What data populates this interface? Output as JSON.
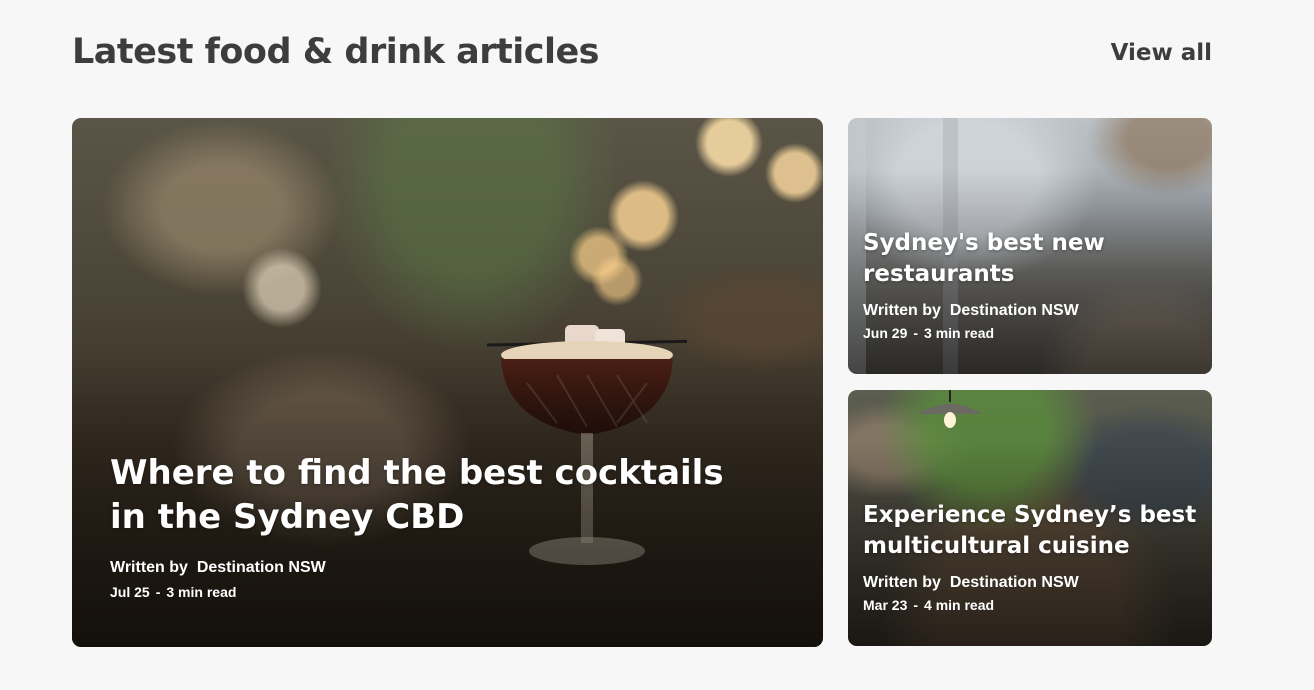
{
  "section": {
    "title": "Latest food & drink articles",
    "view_all_label": "View all"
  },
  "articles": [
    {
      "title": "Where to find the best cocktails in the Sydney CBD",
      "written_by_label": "Written by",
      "author": "Destination NSW",
      "date": "Jul 25",
      "separator": "-",
      "read_time": "3 min read"
    },
    {
      "title": "Sydney's best new restaurants",
      "written_by_label": "Written by",
      "author": "Destination NSW",
      "date": "Jun 29",
      "separator": "-",
      "read_time": "3 min read"
    },
    {
      "title": "Experience Sydney’s best multicultural cuisine",
      "written_by_label": "Written by",
      "author": "Destination NSW",
      "date": "Mar 23",
      "separator": "-",
      "read_time": "4 min read"
    }
  ],
  "colors": {
    "page_background": "#f7f7f7",
    "heading_text": "#3d3d3d",
    "card_text": "#ffffff"
  }
}
